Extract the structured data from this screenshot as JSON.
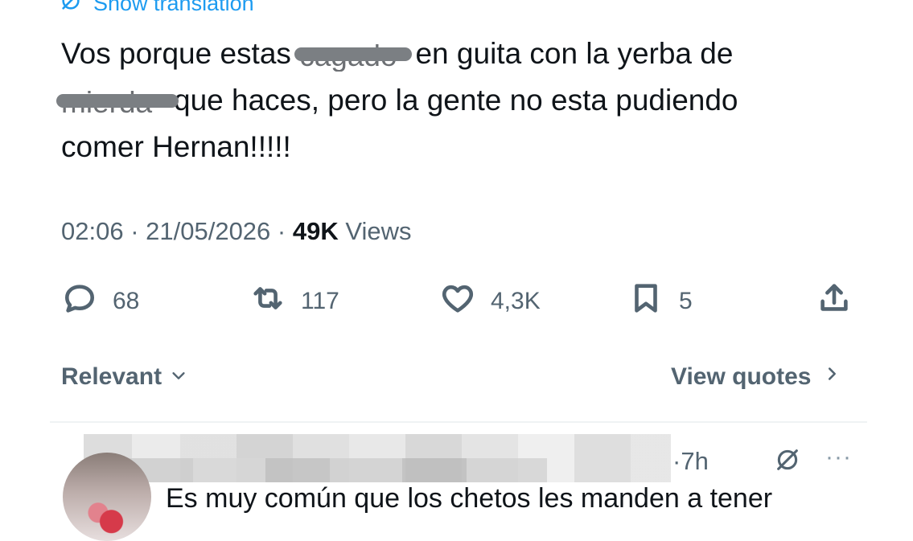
{
  "tweet": {
    "show_translation": "Show translation",
    "line1_before": "Vos porque estas ",
    "line1_redacted": "cagado",
    "line1_after": " en guita con la yerba de",
    "line2_redacted": "mierda",
    "line2_after": "que haces, pero la gente no esta pudiendo",
    "line3": "comer Hernan!!!!!",
    "time": "02:06",
    "date": "21/05/2026",
    "views_count": "49K",
    "views_label": "Views"
  },
  "actions": {
    "replies": "68",
    "reposts": "117",
    "likes": "4,3K",
    "bookmarks": "5"
  },
  "sort": {
    "relevant_label": "Relevant",
    "view_quotes_label": "View quotes"
  },
  "reply": {
    "time": "7h",
    "text": "Es muy común que los chetos les manden a tener"
  },
  "colors": {
    "accent": "#1d9bf0",
    "secondary_text": "#536471",
    "primary_text": "#0f1419"
  }
}
